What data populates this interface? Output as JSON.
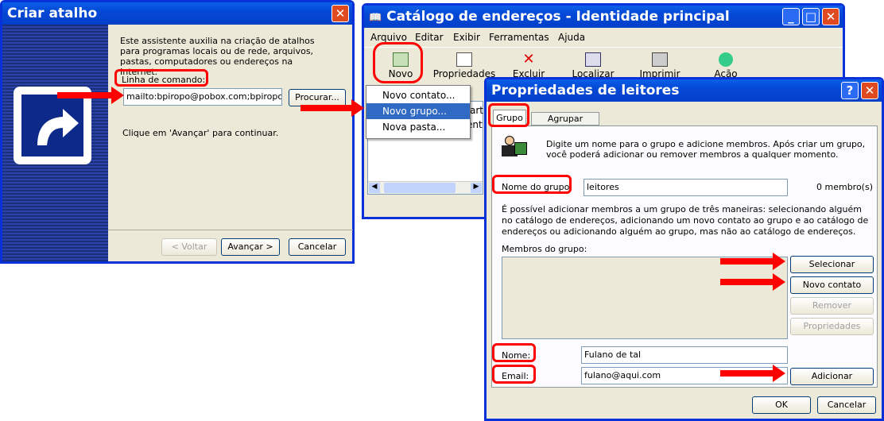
{
  "wizard": {
    "title": "Criar atalho",
    "intro": "Este assistente auxilia na criação de atalhos para programas locais ou de rede, arquivos, pastas, computadores ou endereços na Internet.",
    "cmd_label": "Linha de comando:",
    "cmd_value": "mailto:bpiropo@pobox.com;bpiropo@m",
    "browse": "Procurar...",
    "hint": "Clique em 'Avançar' para continuar.",
    "back": "< Voltar",
    "next": "Avançar >",
    "cancel": "Cancelar"
  },
  "addressbook": {
    "title": "Catálogo de endereços - Identidade principal",
    "menu": [
      "Arquivo",
      "Editar",
      "Exibir",
      "Ferramentas",
      "Ajuda"
    ],
    "toolbar": [
      "Novo",
      "Propriedades",
      "Excluir",
      "Localizar",
      "Imprimir",
      "Ação"
    ],
    "dropdown": [
      "Novo contato...",
      "Novo grupo...",
      "Nova pasta..."
    ],
    "list_fragments": [
      "art",
      "ent"
    ]
  },
  "props": {
    "title": "Propriedades de leitores",
    "tabs": [
      "Grupo",
      "Agrupar detalhes"
    ],
    "intro": "Digite um nome para o grupo e adicione membros. Após criar um grupo, você poderá adicionar ou remover membros a qualquer momento.",
    "group_name_label": "Nome do grupo:",
    "group_name_value": "leitores",
    "member_count": "0 membro(s)",
    "explain": "É possível adicionar membros a um grupo de três maneiras: selecionando alguém no catálogo de endereços, adicionando um novo contato ao grupo e ao catálogo de endereços ou adicionando alguém ao grupo, mas não ao catálogo de endereços.",
    "members_label": "Membros do grupo:",
    "btn_select": "Selecionar membros",
    "btn_new_contact": "Novo contato",
    "btn_remove": "Remover",
    "btn_properties": "Propriedades",
    "name_label": "Nome:",
    "name_value": "Fulano de tal",
    "email_label": "Email:",
    "email_value": "fulano@aqui.com",
    "btn_add": "Adicionar",
    "ok": "OK",
    "cancel": "Cancelar"
  },
  "colors": {
    "accent": "#ff0000",
    "titlebar": "#0448d6",
    "face": "#ece9d8"
  }
}
